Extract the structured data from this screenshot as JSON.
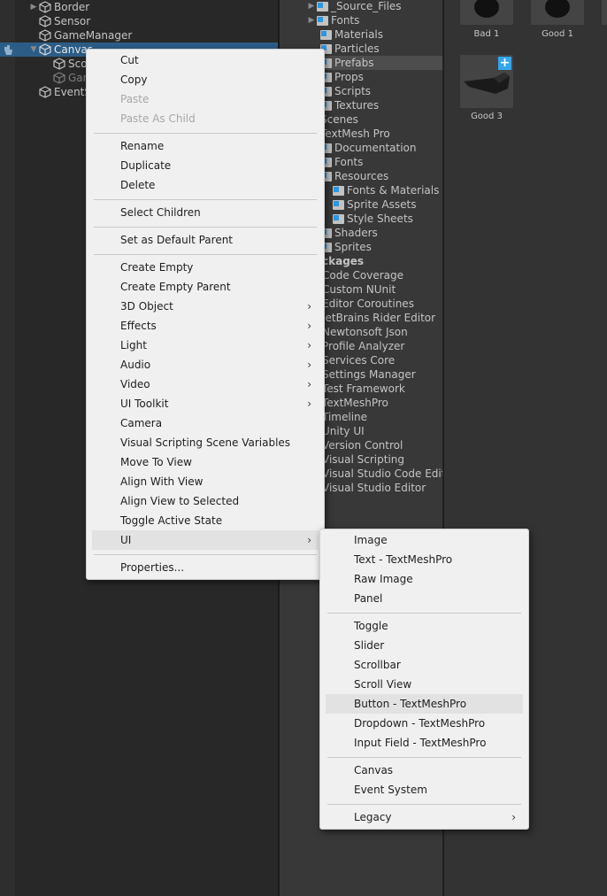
{
  "hierarchy": {
    "items": [
      {
        "label": "Border",
        "dim": false
      },
      {
        "label": "Sensor",
        "dim": false
      },
      {
        "label": "GameManager",
        "dim": false
      },
      {
        "label": "Canvas",
        "dim": false
      },
      {
        "label": "Sco",
        "dim": false
      },
      {
        "label": "Gar",
        "dim": true
      },
      {
        "label": "EventS",
        "dim": false
      }
    ]
  },
  "project": {
    "items": [
      {
        "label": "_Source_Files",
        "icon": "folder"
      },
      {
        "label": "Fonts",
        "icon": "folder"
      },
      {
        "label": "Materials",
        "icon": "folder"
      },
      {
        "label": "Particles",
        "icon": "folder"
      },
      {
        "label": "Prefabs",
        "icon": "folder"
      },
      {
        "label": "Props",
        "icon": "folder"
      },
      {
        "label": "Scripts",
        "icon": "folder"
      },
      {
        "label": "Textures",
        "icon": "folder"
      },
      {
        "label": "Scenes",
        "icon": "folder"
      },
      {
        "label": "TextMesh Pro",
        "icon": "folder"
      },
      {
        "label": "Documentation",
        "icon": "folder"
      },
      {
        "label": "Fonts",
        "icon": "folder"
      },
      {
        "label": "Resources",
        "icon": "folder"
      },
      {
        "label": "Fonts & Materials",
        "icon": "folder"
      },
      {
        "label": "Sprite Assets",
        "icon": "folder"
      },
      {
        "label": "Style Sheets",
        "icon": "folder"
      },
      {
        "label": "Shaders",
        "icon": "folder"
      },
      {
        "label": "Sprites",
        "icon": "folder"
      },
      {
        "label": "ckages",
        "icon": "none"
      },
      {
        "label": "Code Coverage",
        "icon": "none"
      },
      {
        "label": "Custom NUnit",
        "icon": "none"
      },
      {
        "label": "Editor Coroutines",
        "icon": "none"
      },
      {
        "label": "JetBrains Rider Editor",
        "icon": "none"
      },
      {
        "label": "Newtonsoft Json",
        "icon": "none"
      },
      {
        "label": "Profile Analyzer",
        "icon": "none"
      },
      {
        "label": "Services Core",
        "icon": "none"
      },
      {
        "label": "Settings Manager",
        "icon": "none"
      },
      {
        "label": "Test Framework",
        "icon": "none"
      },
      {
        "label": "TextMeshPro",
        "icon": "none"
      },
      {
        "label": "Timeline",
        "icon": "none"
      },
      {
        "label": "Unity UI",
        "icon": "none"
      },
      {
        "label": "Version Control",
        "icon": "none"
      },
      {
        "label": "Visual Scripting",
        "icon": "none"
      },
      {
        "label": "Visual Studio Code Edito",
        "icon": "none"
      },
      {
        "label": "Visual Studio Editor",
        "icon": "none"
      }
    ]
  },
  "assets": [
    {
      "label": "Bad 1"
    },
    {
      "label": "Good 1"
    },
    {
      "label": "Good 3"
    }
  ],
  "context_menu": {
    "items": [
      {
        "label": "Cut"
      },
      {
        "label": "Copy"
      },
      {
        "label": "Paste"
      },
      {
        "label": "Paste As Child"
      },
      {
        "label": "Rename"
      },
      {
        "label": "Duplicate"
      },
      {
        "label": "Delete"
      },
      {
        "label": "Select Children"
      },
      {
        "label": "Set as Default Parent"
      },
      {
        "label": "Create Empty"
      },
      {
        "label": "Create Empty Parent"
      },
      {
        "label": "3D Object"
      },
      {
        "label": "Effects"
      },
      {
        "label": "Light"
      },
      {
        "label": "Audio"
      },
      {
        "label": "Video"
      },
      {
        "label": "UI Toolkit"
      },
      {
        "label": "Camera"
      },
      {
        "label": "Visual Scripting Scene Variables"
      },
      {
        "label": "Move To View"
      },
      {
        "label": "Align With View"
      },
      {
        "label": "Align View to Selected"
      },
      {
        "label": "Toggle Active State"
      },
      {
        "label": "UI"
      },
      {
        "label": "Properties..."
      }
    ]
  },
  "ui_submenu": {
    "items": [
      {
        "label": "Image"
      },
      {
        "label": "Text - TextMeshPro"
      },
      {
        "label": "Raw Image"
      },
      {
        "label": "Panel"
      },
      {
        "label": "Toggle"
      },
      {
        "label": "Slider"
      },
      {
        "label": "Scrollbar"
      },
      {
        "label": "Scroll View"
      },
      {
        "label": "Button - TextMeshPro"
      },
      {
        "label": "Dropdown - TextMeshPro"
      },
      {
        "label": "Input Field - TextMeshPro"
      },
      {
        "label": "Canvas"
      },
      {
        "label": "Event System"
      },
      {
        "label": "Legacy"
      }
    ]
  },
  "icons": {
    "submenu_arrow": "›",
    "expand_arrow": "▶",
    "collapse_arrow": "▼",
    "plus": "+"
  },
  "colors": {
    "selection": "#2c5d87",
    "badge": "#34a6ec"
  }
}
